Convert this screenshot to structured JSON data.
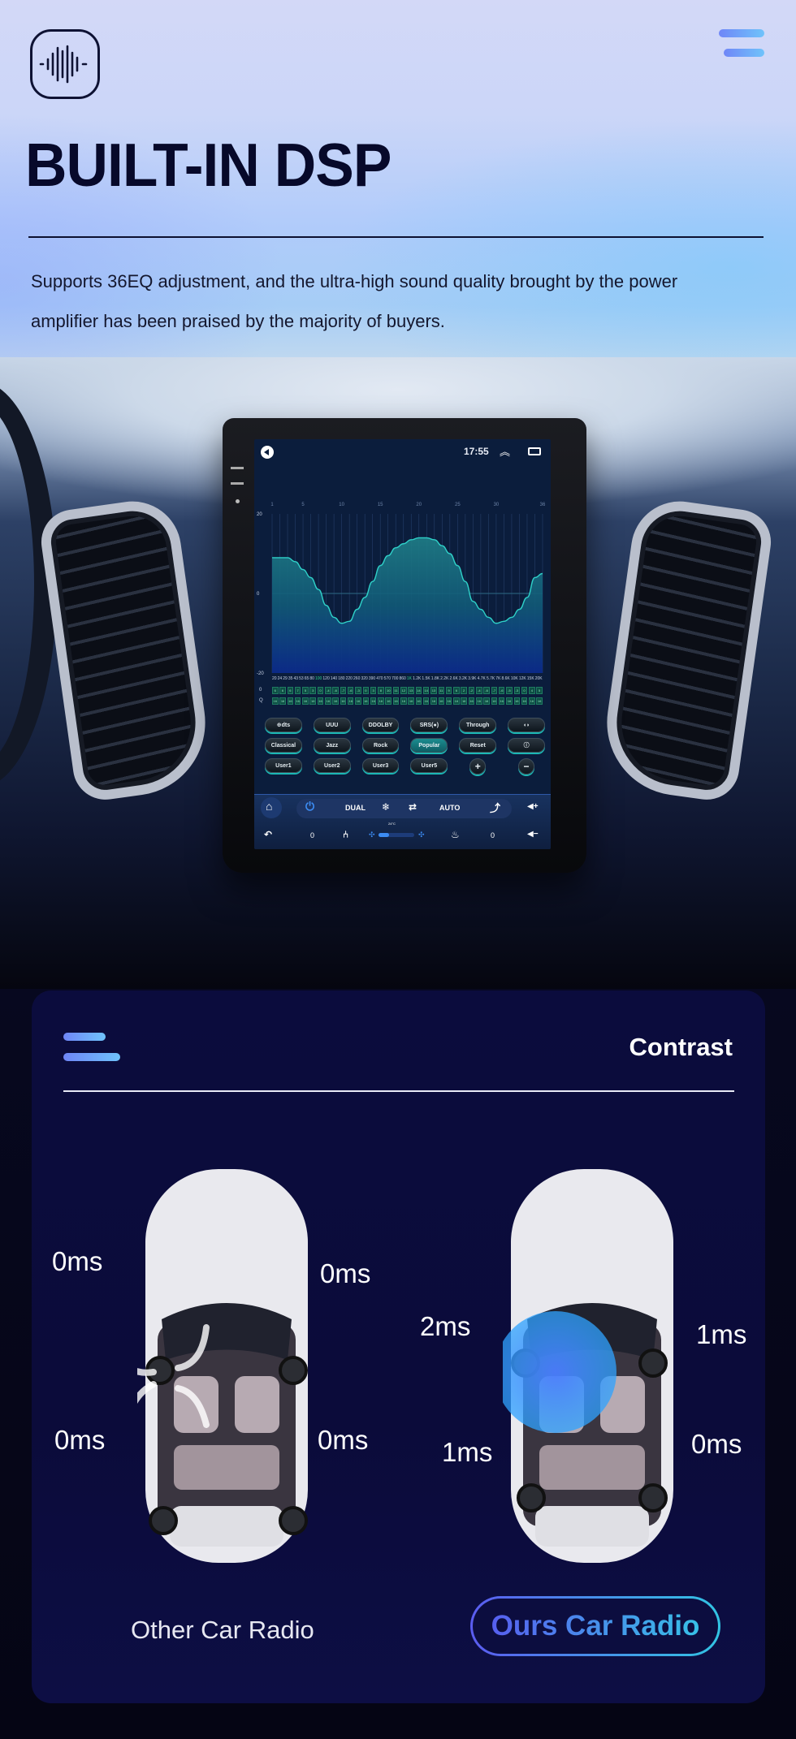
{
  "hero": {
    "logo_icon": "sound-wave-icon",
    "menu_icon": "menu-icon",
    "title": "BUILT-IN DSP",
    "description": "Supports 36EQ adjustment, and the ultra-high sound quality brought by the power amplifier has been praised by the majority of buyers."
  },
  "screen": {
    "status_bar": {
      "time": "17:55",
      "up_icon": "︽"
    },
    "equalizer": {
      "band_labels": [
        "1",
        "5",
        "10",
        "15",
        "20",
        "25",
        "30",
        "36"
      ],
      "y_labels": [
        "20",
        "0",
        "-20"
      ],
      "ylim": [
        -20,
        20
      ],
      "band_count": 36,
      "gains": [
        9,
        9,
        9,
        8,
        6,
        4,
        1,
        -3,
        -6,
        -7.5,
        -7,
        -4,
        -1,
        3,
        7,
        9.5,
        11.5,
        12.5,
        13.5,
        14,
        14,
        13.5,
        12,
        10,
        7,
        3,
        -2,
        -4,
        -6,
        -7.5,
        -7,
        -6,
        -4,
        -1,
        4,
        5
      ],
      "frequencies": [
        "20",
        "24",
        "29",
        "35",
        "43",
        "53",
        "65",
        "80",
        "100",
        "120",
        "140",
        "180",
        "220",
        "260",
        "320",
        "390",
        "470",
        "570",
        "700",
        "860",
        "1K",
        "1.2K",
        "1.5K",
        "1.8K",
        "2.2K",
        "2.6K",
        "3.2K",
        "3.9K",
        "4.7K",
        "5.7K",
        "7K",
        "8.6K",
        "10K",
        "12K",
        "15K",
        "20K"
      ],
      "highlighted_frequencies": [
        8,
        20
      ],
      "row_labels": [
        "0",
        "Q"
      ],
      "slot_values_a": [
        "6",
        "6",
        "6",
        "7",
        "5",
        "3",
        "0",
        "-4",
        "-6",
        "-7",
        "-6",
        "-3",
        "0",
        "3",
        "8",
        "10",
        "11",
        "12",
        "13",
        "14",
        "14",
        "13",
        "11",
        "9",
        "6",
        "2",
        "-2",
        "-4",
        "-6",
        "-7",
        "-6",
        "-5",
        "-3",
        "0",
        "4",
        "5"
      ],
      "slot_values_b": [
        "16",
        "16",
        "16",
        "16",
        "16",
        "16",
        "16",
        "16",
        "16",
        "16",
        "16",
        "16",
        "16",
        "16",
        "16",
        "16",
        "16",
        "16",
        "16",
        "16",
        "16",
        "16",
        "16",
        "16",
        "16",
        "16",
        "16",
        "16",
        "16",
        "16",
        "16",
        "16",
        "16",
        "16",
        "16",
        "16"
      ]
    },
    "buttons": [
      {
        "label": "⊕dts",
        "name": "dts-button",
        "active": false,
        "round": false
      },
      {
        "label": "UUU",
        "name": "bass-button",
        "active": false,
        "round": false
      },
      {
        "label": "DDOLBY",
        "name": "dolby-button",
        "active": false,
        "round": false
      },
      {
        "label": "SRS(●)",
        "name": "srs-button",
        "active": false,
        "round": false
      },
      {
        "label": "Through",
        "name": "through-button",
        "active": false,
        "round": false
      },
      {
        "label": "◖◗",
        "name": "balance-button",
        "active": false,
        "round": false
      },
      {
        "label": "Classical",
        "name": "preset-classical-button",
        "active": false,
        "round": false
      },
      {
        "label": "Jazz",
        "name": "preset-jazz-button",
        "active": false,
        "round": false
      },
      {
        "label": "Rock",
        "name": "preset-rock-button",
        "active": false,
        "round": false
      },
      {
        "label": "Popular",
        "name": "preset-popular-button",
        "active": true,
        "round": false
      },
      {
        "label": "Reset",
        "name": "reset-button",
        "active": false,
        "round": false
      },
      {
        "label": "ⓘ",
        "name": "info-button",
        "active": false,
        "round": false
      },
      {
        "label": "User1",
        "name": "preset-user1-button",
        "active": false,
        "round": false
      },
      {
        "label": "User2",
        "name": "preset-user2-button",
        "active": false,
        "round": false
      },
      {
        "label": "User3",
        "name": "preset-user3-button",
        "active": false,
        "round": false
      },
      {
        "label": "User5",
        "name": "preset-user5-button",
        "active": false,
        "round": false
      },
      {
        "label": "+",
        "name": "add-preset-button",
        "active": false,
        "round": true
      },
      {
        "label": "−",
        "name": "remove-preset-button",
        "active": false,
        "round": true
      }
    ],
    "climate": {
      "power_icon": "⏻",
      "dual": "DUAL",
      "ac_icon": "❄",
      "recirc_icon": "⇄",
      "auto": "AUTO",
      "airflow_icon": "⤴",
      "vol_up": "◀+",
      "back_icon": "↶",
      "temp": "24°C",
      "left_value": "0",
      "seat_icon": "⑃",
      "fan_icon": "✣",
      "fan_level": 0.3,
      "seat_heat_icon": "♨",
      "right_value": "0",
      "vol_down": "◀−"
    }
  },
  "contrast": {
    "title": "Contrast",
    "other": {
      "caption": "Other Car Radio",
      "delays": {
        "front_left": "0ms",
        "front_right": "0ms",
        "rear_left": "0ms",
        "rear_right": "0ms"
      }
    },
    "ours": {
      "caption": "Ours Car Radio",
      "delays": {
        "front_left": "2ms",
        "front_right": "1ms",
        "rear_left": "1ms",
        "rear_right": "0ms"
      }
    },
    "colors": {
      "accent_start": "#5a57f0",
      "accent_end": "#35c8e6"
    }
  }
}
